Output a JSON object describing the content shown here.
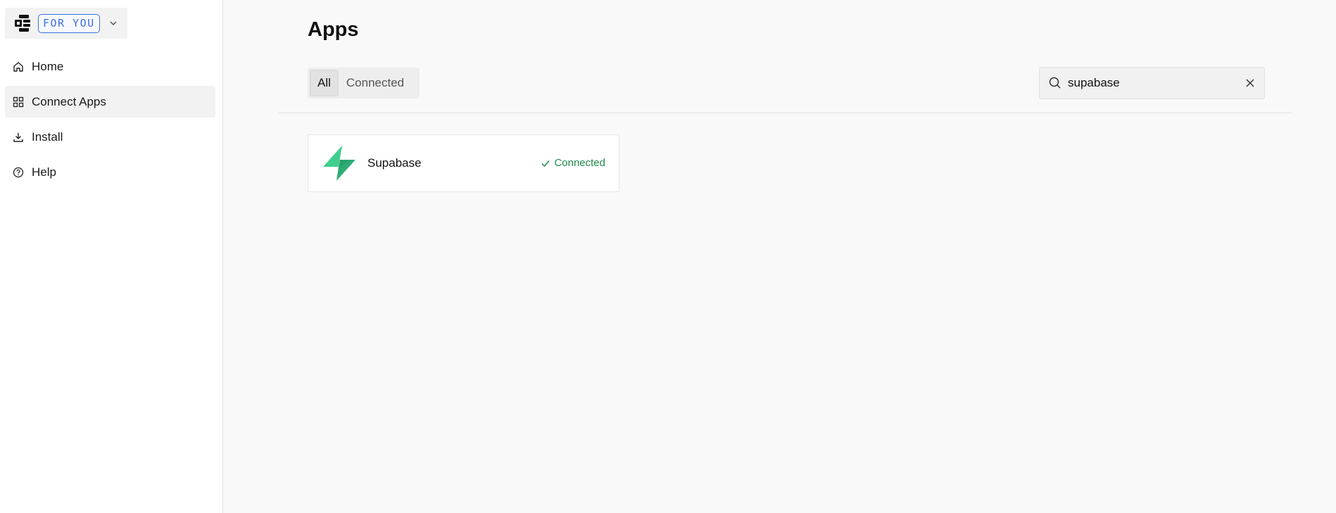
{
  "sidebar": {
    "workspace_badge": "FOR YOU",
    "items": [
      {
        "label": "Home",
        "icon": "home-icon"
      },
      {
        "label": "Connect Apps",
        "icon": "grid-icon",
        "active": true
      },
      {
        "label": "Install",
        "icon": "download-icon"
      },
      {
        "label": "Help",
        "icon": "help-circle-icon"
      }
    ]
  },
  "main": {
    "title": "Apps",
    "tabs": [
      {
        "label": "All",
        "active": true
      },
      {
        "label": "Connected",
        "active": false
      }
    ],
    "search": {
      "value": "supabase",
      "placeholder": ""
    },
    "apps": [
      {
        "name": "Supabase",
        "status": "Connected",
        "status_color": "#1f8a4c"
      }
    ]
  },
  "colors": {
    "accent_blue": "#3d6fe0",
    "supabase_green": "#3ecf8e",
    "connected_green": "#1f8a4c"
  }
}
